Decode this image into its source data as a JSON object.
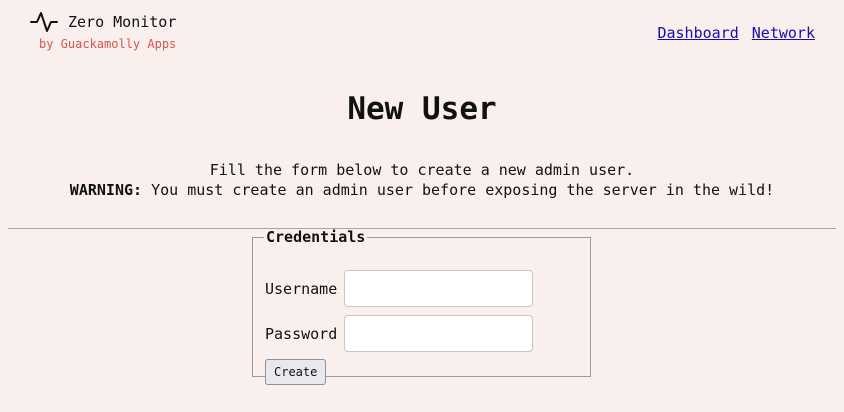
{
  "brand": {
    "title": "Zero Monitor",
    "subtitle": "by Guackamolly Apps",
    "icon": "activity-pulse-icon",
    "subtitle_color": "#d9534f"
  },
  "nav": {
    "links": [
      {
        "label": "Dashboard"
      },
      {
        "label": "Network"
      }
    ],
    "link_color": "#1a0dab"
  },
  "page": {
    "title": "New User",
    "intro": "Fill the form below to create a new admin user.",
    "warning_label": "WARNING:",
    "warning_text": " You must create an admin user before exposing the server in the wild!",
    "background": "#f9efec"
  },
  "form": {
    "legend": "Credentials",
    "username": {
      "label": "Username",
      "value": "",
      "placeholder": ""
    },
    "password": {
      "label": "Password",
      "value": "",
      "placeholder": ""
    },
    "submit_label": "Create"
  }
}
